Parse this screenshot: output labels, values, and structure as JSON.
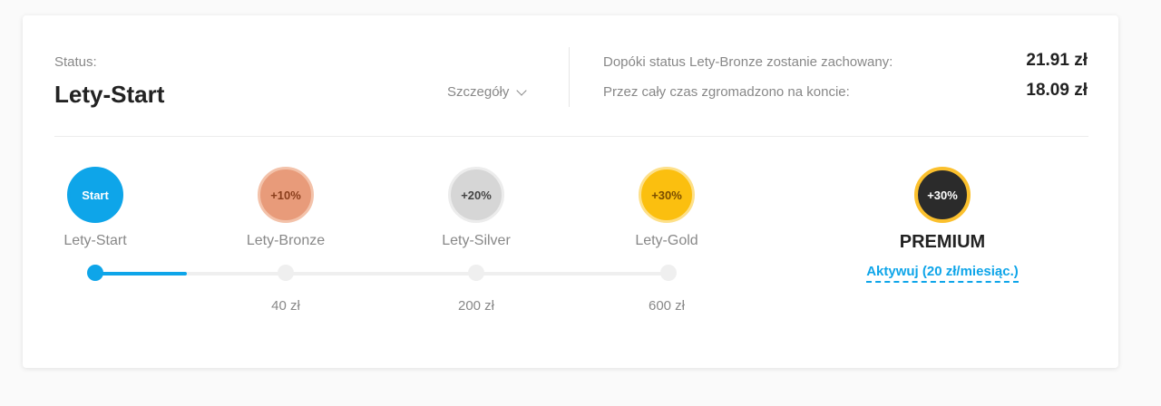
{
  "status": {
    "label": "Status:",
    "name": "Lety-Start",
    "details_label": "Szczegóły"
  },
  "info": {
    "keep_label": "Dopóki status Lety-Bronze zostanie zachowany:",
    "keep_value": "21.91 zł",
    "total_label": "Przez cały czas zgromadzono na koncie:",
    "total_value": "18.09 zł"
  },
  "levels": [
    {
      "badge": "Start",
      "name": "Lety-Start",
      "threshold": "",
      "bg": "#0ea5e9",
      "border": "#0ea5e9",
      "text": "#ffffff"
    },
    {
      "badge": "+10%",
      "name": "Lety-Bronze",
      "threshold": "40 zł",
      "bg": "#e89b7a",
      "border": "#f3c2aa",
      "text": "#8a3e1c"
    },
    {
      "badge": "+20%",
      "name": "Lety-Silver",
      "threshold": "200 zł",
      "bg": "#d6d6d6",
      "border": "#ececec",
      "text": "#444444"
    },
    {
      "badge": "+30%",
      "name": "Lety-Gold",
      "threshold": "600 zł",
      "bg": "#fbbf0f",
      "border": "#fde08a",
      "text": "#7a4d00"
    }
  ],
  "progress": {
    "fill_fraction": 0.16
  },
  "premium": {
    "badge": "+30%",
    "title": "PREMIUM",
    "activate_label": "Aktywuj (20 zł/miesiąc.)",
    "bg": "#2b2b2b",
    "border": "#fbc02d"
  },
  "colors": {
    "accent": "#0ea5e9"
  }
}
